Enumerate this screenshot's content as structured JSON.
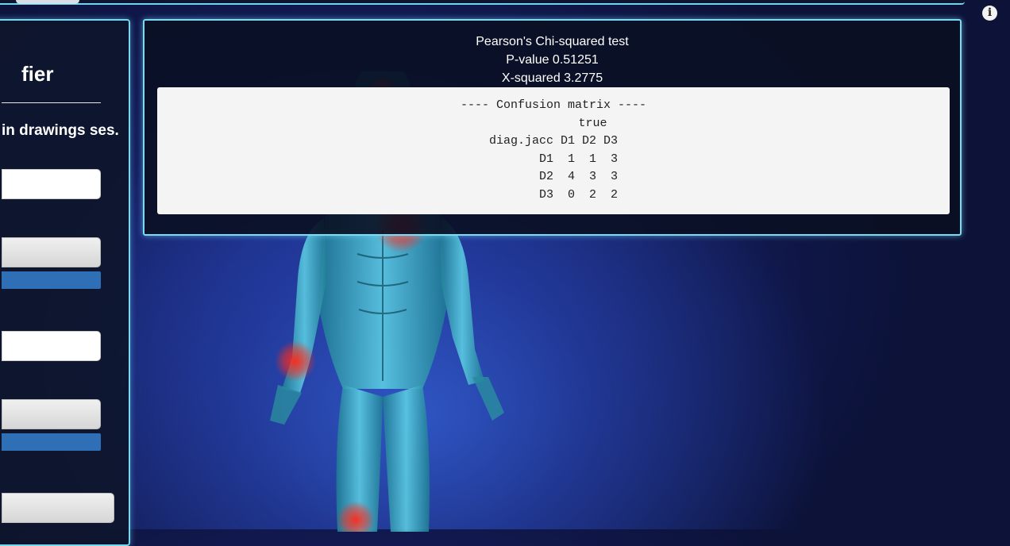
{
  "sidebar": {
    "title": "fier",
    "description": "in drawings ses."
  },
  "results": {
    "test_name": "Pearson's Chi-squared test",
    "p_value": "P-value 0.51251",
    "x_squared": "X-squared 3.2775",
    "matrix_lines": [
      "---- Confusion matrix ----",
      "           true",
      "diag.jacc D1 D2 D3",
      "       D1  1  1  3",
      "       D2  4  3  3",
      "       D3  0  2  2"
    ]
  },
  "colors": {
    "panel_border": "#79dcf3",
    "accent_bar": "#2f6fb5",
    "pain_marker": "#ff2a1a"
  },
  "icons": {
    "info": "info-icon"
  },
  "info_glyph": "i"
}
